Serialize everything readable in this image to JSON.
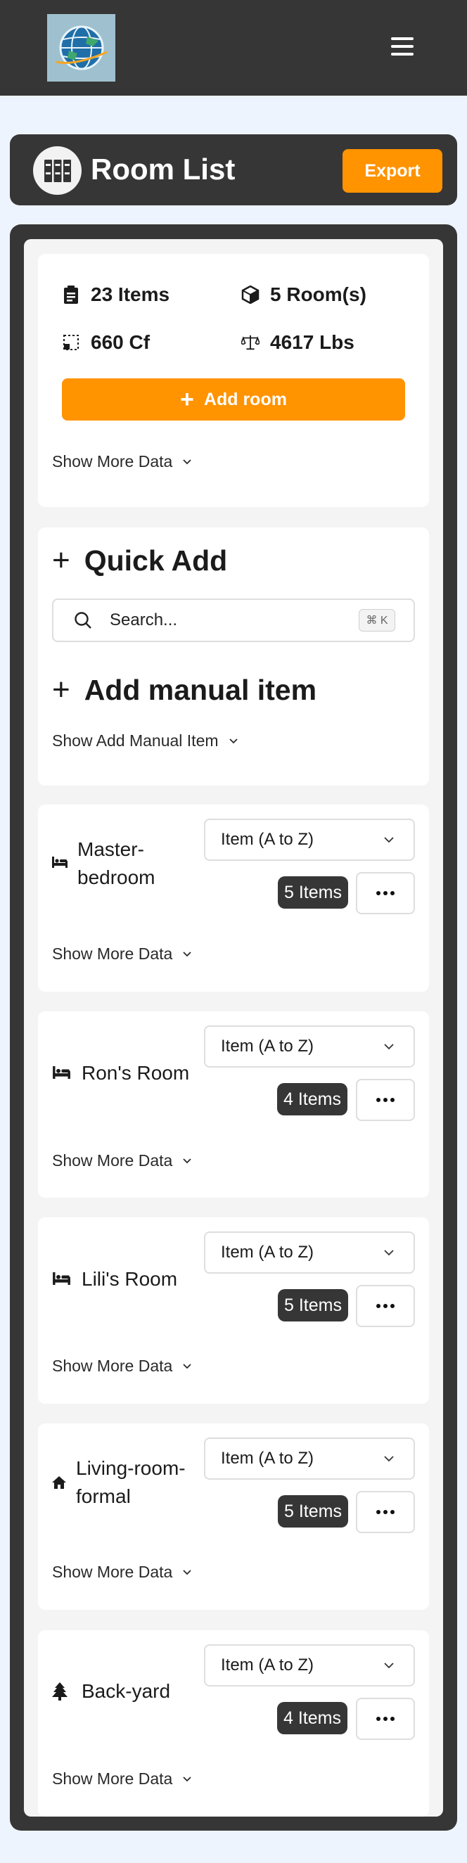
{
  "header": {
    "logo_icon": "globe-logo-icon",
    "menu_icon": "hamburger-menu-icon"
  },
  "title_bar": {
    "icon": "boxes-icon",
    "title": "Room List",
    "export_label": "Export",
    "accent_color": "#ff9300"
  },
  "summary": {
    "items": "23 Items",
    "rooms": "5 Room(s)",
    "volume": "660 Cf",
    "weight": "4617 Lbs",
    "add_room_label": "Add room",
    "show_more_label": "Show More Data"
  },
  "quick_add": {
    "heading": "Quick Add",
    "search_placeholder": "Search...",
    "shortcut": "⌘ K",
    "manual_heading": "Add manual item",
    "show_manual_label": "Show Add Manual Item"
  },
  "rooms": [
    {
      "name_line1": "Master-",
      "name_line2": "bedroom",
      "icon": "bed-icon",
      "sort": "Item (A to Z)",
      "count": "5 Items",
      "show_more_label": "Show More Data"
    },
    {
      "name": "Ron's Room",
      "icon": "bed-icon",
      "sort": "Item (A to Z)",
      "count": "4 Items",
      "show_more_label": "Show More Data"
    },
    {
      "name": "Lili's Room",
      "icon": "bed-icon",
      "sort": "Item (A to Z)",
      "count": "5 Items",
      "show_more_label": "Show More Data"
    },
    {
      "name_line1": "Living-room-",
      "name_line2": "formal",
      "icon": "house-icon",
      "sort": "Item (A to Z)",
      "count": "5 Items",
      "show_more_label": "Show More Data"
    },
    {
      "name": "Back-yard",
      "icon": "tree-icon",
      "sort": "Item (A to Z)",
      "count": "4 Items",
      "show_more_label": "Show More Data"
    }
  ]
}
